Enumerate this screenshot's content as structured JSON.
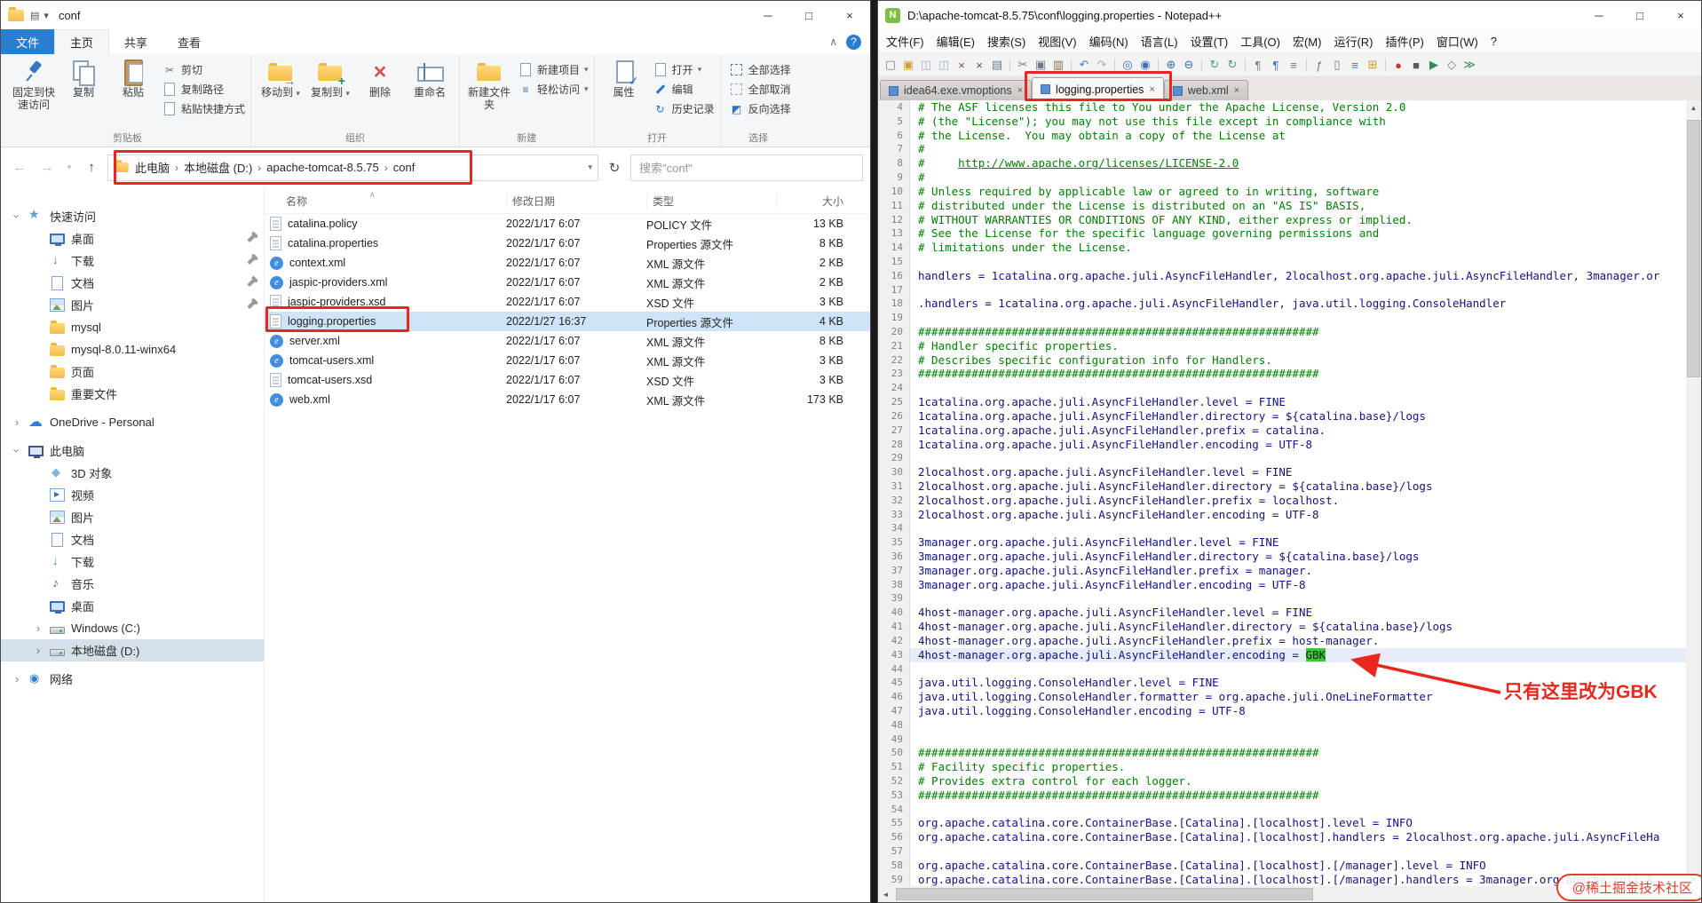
{
  "icons": {
    "back": "←",
    "forward": "→",
    "up": "↑",
    "dropdown": "▾",
    "refresh": "↻",
    "help": "?",
    "collapse": "∧",
    "min": "─",
    "max": "□",
    "close": "×",
    "chev_right": "›",
    "cut": "✂",
    "delete_x": "×",
    "history": "↻",
    "easy": "≡",
    "check": "✓",
    "invert": "◩",
    "arrow_move": "→",
    "plus": "+",
    "sort_caret": "∧",
    "scroll_up": "▲",
    "scroll_down": "▼",
    "scroll_left": "◄",
    "scroll_right": "►"
  },
  "explorer": {
    "title": "conf",
    "ribbon_tabs": [
      "文件",
      "主页",
      "共享",
      "查看"
    ],
    "ribbon": {
      "pin": "固定到快速访问",
      "copy": "复制",
      "paste": "粘贴",
      "cut": "剪切",
      "copy_path": "复制路径",
      "paste_shortcut": "粘贴快捷方式",
      "group_clipboard": "剪贴板",
      "move_to": "移动到",
      "copy_to": "复制到",
      "delete": "删除",
      "rename": "重命名",
      "group_organize": "组织",
      "new_folder": "新建文件夹",
      "new_item": "新建项目",
      "easy_access": "轻松访问",
      "group_new": "新建",
      "properties": "属性",
      "open": "打开",
      "edit": "编辑",
      "history": "历史记录",
      "group_open": "打开",
      "select_all": "全部选择",
      "select_none": "全部取消",
      "invert_selection": "反向选择",
      "group_select": "选择"
    },
    "address": {
      "crumbs": [
        "此电脑",
        "本地磁盘 (D:)",
        "apache-tomcat-8.5.75",
        "conf"
      ],
      "search": "搜索\"conf\""
    },
    "sidebar": [
      {
        "id": "quick-access",
        "label": "快速访问",
        "icon": "star",
        "chev": "down",
        "indent": 0
      },
      {
        "id": "desktop-pinned",
        "label": "桌面",
        "icon": "monitor",
        "pin": true,
        "indent": 1
      },
      {
        "id": "downloads-pinned",
        "label": "下载",
        "icon": "download",
        "pin": true,
        "indent": 1
      },
      {
        "id": "documents-pinned",
        "label": "文档",
        "icon": "doc",
        "pin": true,
        "indent": 1
      },
      {
        "id": "pictures-pinned",
        "label": "图片",
        "icon": "pic",
        "pin": true,
        "indent": 1
      },
      {
        "id": "mysql",
        "label": "mysql",
        "icon": "folder",
        "indent": 1
      },
      {
        "id": "mysql-8",
        "label": "mysql-8.0.11-winx64",
        "icon": "folder",
        "indent": 1
      },
      {
        "id": "pages",
        "label": "页面",
        "icon": "folder",
        "indent": 1
      },
      {
        "id": "important",
        "label": "重要文件",
        "icon": "folder",
        "indent": 1
      },
      {
        "id": "onedrive",
        "label": "OneDrive - Personal",
        "icon": "cloud",
        "chev": "right",
        "indent": 0,
        "gap": true
      },
      {
        "id": "this-pc",
        "label": "此电脑",
        "icon": "pc",
        "chev": "down",
        "indent": 0,
        "gap": true
      },
      {
        "id": "3d-objects",
        "label": "3D 对象",
        "icon": "obj3d",
        "indent": 1
      },
      {
        "id": "videos",
        "label": "视频",
        "icon": "video",
        "indent": 1
      },
      {
        "id": "pictures",
        "label": "图片",
        "icon": "pic",
        "indent": 1
      },
      {
        "id": "documents",
        "label": "文档",
        "icon": "doc",
        "indent": 1
      },
      {
        "id": "downloads",
        "label": "下载",
        "icon": "download",
        "indent": 1
      },
      {
        "id": "music",
        "label": "音乐",
        "icon": "music",
        "indent": 1
      },
      {
        "id": "desktop",
        "label": "桌面",
        "icon": "monitor",
        "indent": 1
      },
      {
        "id": "drive-c",
        "label": "Windows (C:)",
        "icon": "drive",
        "chev": "right",
        "indent": 1
      },
      {
        "id": "drive-d",
        "label": "本地磁盘 (D:)",
        "icon": "drive",
        "chev": "right",
        "indent": 1,
        "selected": true
      },
      {
        "id": "network",
        "label": "网络",
        "icon": "net",
        "chev": "right",
        "indent": 0,
        "gap": true
      }
    ],
    "files": {
      "columns": [
        "名称",
        "修改日期",
        "类型",
        "大小"
      ],
      "rows": [
        {
          "name": "catalina.policy",
          "icon": "doc",
          "date": "2022/1/17 6:07",
          "type": "POLICY 文件",
          "size": "13 KB"
        },
        {
          "name": "catalina.properties",
          "icon": "doc",
          "date": "2022/1/17 6:07",
          "type": "Properties 源文件",
          "size": "8 KB"
        },
        {
          "name": "context.xml",
          "icon": "xml",
          "date": "2022/1/17 6:07",
          "type": "XML 源文件",
          "size": "2 KB"
        },
        {
          "name": "jaspic-providers.xml",
          "icon": "xml",
          "date": "2022/1/17 6:07",
          "type": "XML 源文件",
          "size": "2 KB"
        },
        {
          "name": "jaspic-providers.xsd",
          "icon": "doc",
          "date": "2022/1/17 6:07",
          "type": "XSD 文件",
          "size": "3 KB"
        },
        {
          "name": "logging.properties",
          "icon": "doc",
          "date": "2022/1/27 16:37",
          "type": "Properties 源文件",
          "size": "4 KB",
          "selected": true
        },
        {
          "name": "server.xml",
          "icon": "xml",
          "date": "2022/1/17 6:07",
          "type": "XML 源文件",
          "size": "8 KB"
        },
        {
          "name": "tomcat-users.xml",
          "icon": "xml",
          "date": "2022/1/17 6:07",
          "type": "XML 源文件",
          "size": "3 KB"
        },
        {
          "name": "tomcat-users.xsd",
          "icon": "doc",
          "date": "2022/1/17 6:07",
          "type": "XSD 文件",
          "size": "3 KB"
        },
        {
          "name": "web.xml",
          "icon": "xml",
          "date": "2022/1/17 6:07",
          "type": "XML 源文件",
          "size": "173 KB"
        }
      ]
    }
  },
  "notepad": {
    "title": "D:\\apache-tomcat-8.5.75\\conf\\logging.properties - Notepad++",
    "icon_label": "N",
    "menus": [
      "文件(F)",
      "编辑(E)",
      "搜索(S)",
      "视图(V)",
      "编码(N)",
      "语言(L)",
      "设置(T)",
      "工具(O)",
      "宏(M)",
      "运行(R)",
      "插件(P)",
      "窗口(W)",
      "?"
    ],
    "toolbar": [
      {
        "n": "new-file-icon",
        "g": "▢",
        "c": "#6b7b8d"
      },
      {
        "n": "open-file-icon",
        "g": "▣",
        "c": "#d09a3e"
      },
      {
        "n": "save-icon",
        "g": "◫",
        "c": "#9fb3c8"
      },
      {
        "n": "save-all-icon",
        "g": "◫",
        "c": "#9fb3c8"
      },
      {
        "n": "close-doc-icon",
        "g": "×",
        "c": "#7d4a4a"
      },
      {
        "n": "close-all-icon",
        "g": "×",
        "c": "#7d4a4a"
      },
      {
        "n": "print-icon",
        "g": "▤",
        "c": "#6b7b8d"
      },
      {
        "sep": true
      },
      {
        "n": "cut-icon",
        "g": "✂",
        "c": "#6b7b8d"
      },
      {
        "n": "copy-icon",
        "g": "▣",
        "c": "#6b7b8d"
      },
      {
        "n": "paste-icon",
        "g": "▥",
        "c": "#8a6d4a"
      },
      {
        "sep": true
      },
      {
        "n": "undo-icon",
        "g": "↶",
        "c": "#4f7fc9"
      },
      {
        "n": "redo-icon",
        "g": "↷",
        "c": "#9fb3c8"
      },
      {
        "sep": true
      },
      {
        "n": "find-icon",
        "g": "◎",
        "c": "#3a6fb0"
      },
      {
        "n": "replace-icon",
        "g": "◉",
        "c": "#3a6fb0"
      },
      {
        "sep": true
      },
      {
        "n": "zoom-in-icon",
        "g": "⊕",
        "c": "#3a6fb0"
      },
      {
        "n": "zoom-out-icon",
        "g": "⊖",
        "c": "#3a6fb0"
      },
      {
        "sep": true
      },
      {
        "n": "sync-vertical-icon",
        "g": "↻",
        "c": "#4f9f6f"
      },
      {
        "n": "sync-horizontal-icon",
        "g": "↻",
        "c": "#4f9f6f"
      },
      {
        "sep": true
      },
      {
        "n": "word-wrap-icon",
        "g": "¶",
        "c": "#6b7b8d"
      },
      {
        "n": "show-all-chars-icon",
        "g": "¶",
        "c": "#3a6fb0"
      },
      {
        "n": "indent-guide-icon",
        "g": "≡",
        "c": "#6b7b8d"
      },
      {
        "sep": true
      },
      {
        "n": "function-list-icon",
        "g": "ƒ",
        "c": "#6b7b8d"
      },
      {
        "n": "doc-map-icon",
        "g": "▯",
        "c": "#6b7b8d"
      },
      {
        "n": "doc-list-icon",
        "g": "≡",
        "c": "#3a6fb0"
      },
      {
        "n": "folder-workspace-icon",
        "g": "⊞",
        "c": "#d09a3e"
      },
      {
        "sep": true
      },
      {
        "n": "macro-record-icon",
        "g": "●",
        "c": "#c23b2e"
      },
      {
        "n": "macro-stop-icon",
        "g": "■",
        "c": "#5a5a5a"
      },
      {
        "n": "macro-play-icon",
        "g": "▶",
        "c": "#2e8b57"
      },
      {
        "n": "macro-save-icon",
        "g": "◇",
        "c": "#6b7b8d"
      },
      {
        "n": "macro-run-multiple-icon",
        "g": "≫",
        "c": "#2e8b57"
      }
    ],
    "tabs": [
      {
        "label": "idea64.exe.vmoptions",
        "active": false
      },
      {
        "label": "logging.properties",
        "active": true
      },
      {
        "label": "web.xml",
        "active": false
      }
    ],
    "editor": {
      "lines": [
        {
          "n": 4,
          "s": [
            [
              "c",
              "# The ASF licenses this file to You under the Apache License, Version 2.0"
            ]
          ]
        },
        {
          "n": 5,
          "s": [
            [
              "c",
              "# (the \"License\"); you may not use this file except in compliance with"
            ]
          ]
        },
        {
          "n": 6,
          "s": [
            [
              "c",
              "# the License.  You may obtain a copy of the License at"
            ]
          ]
        },
        {
          "n": 7,
          "s": [
            [
              "c",
              "#"
            ]
          ]
        },
        {
          "n": 8,
          "s": [
            [
              "c",
              "#     "
            ],
            [
              "u",
              "http://www.apache.org/licenses/LICENSE-2.0"
            ]
          ]
        },
        {
          "n": 9,
          "s": [
            [
              "c",
              "#"
            ]
          ]
        },
        {
          "n": 10,
          "s": [
            [
              "c",
              "# Unless required by applicable law or agreed to in writing, software"
            ]
          ]
        },
        {
          "n": 11,
          "s": [
            [
              "c",
              "# distributed under the License is distributed on an \"AS IS\" BASIS,"
            ]
          ]
        },
        {
          "n": 12,
          "s": [
            [
              "c",
              "# WITHOUT WARRANTIES OR CONDITIONS OF ANY KIND, either express or implied."
            ]
          ]
        },
        {
          "n": 13,
          "s": [
            [
              "c",
              "# See the License for the specific language governing permissions and"
            ]
          ]
        },
        {
          "n": 14,
          "s": [
            [
              "c",
              "# limitations under the License."
            ]
          ]
        },
        {
          "n": 15,
          "s": []
        },
        {
          "n": 16,
          "s": [
            [
              "k",
              "handlers = 1catalina.org.apache.juli.AsyncFileHandler, 2localhost.org.apache.juli.AsyncFileHandler, 3manager.or"
            ]
          ]
        },
        {
          "n": 17,
          "s": []
        },
        {
          "n": 18,
          "s": [
            [
              "k",
              ".handlers = 1catalina.org.apache.juli.AsyncFileHandler, java.util.logging.ConsoleHandler"
            ]
          ]
        },
        {
          "n": 19,
          "s": []
        },
        {
          "n": 20,
          "s": [
            [
              "c",
              "############################################################"
            ]
          ]
        },
        {
          "n": 21,
          "s": [
            [
              "c",
              "# Handler specific properties."
            ]
          ]
        },
        {
          "n": 22,
          "s": [
            [
              "c",
              "# Describes specific configuration info for Handlers."
            ]
          ]
        },
        {
          "n": 23,
          "s": [
            [
              "c",
              "############################################################"
            ]
          ]
        },
        {
          "n": 24,
          "s": []
        },
        {
          "n": 25,
          "s": [
            [
              "k",
              "1catalina.org.apache.juli.AsyncFileHandler.level = FINE"
            ]
          ]
        },
        {
          "n": 26,
          "s": [
            [
              "k",
              "1catalina.org.apache.juli.AsyncFileHandler.directory = ${catalina.base}/logs"
            ]
          ]
        },
        {
          "n": 27,
          "s": [
            [
              "k",
              "1catalina.org.apache.juli.AsyncFileHandler.prefix = catalina."
            ]
          ]
        },
        {
          "n": 28,
          "s": [
            [
              "k",
              "1catalina.org.apache.juli.AsyncFileHandler.encoding = UTF-8"
            ]
          ]
        },
        {
          "n": 29,
          "s": []
        },
        {
          "n": 30,
          "s": [
            [
              "k",
              "2localhost.org.apache.juli.AsyncFileHandler.level = FINE"
            ]
          ]
        },
        {
          "n": 31,
          "s": [
            [
              "k",
              "2localhost.org.apache.juli.AsyncFileHandler.directory = ${catalina.base}/logs"
            ]
          ]
        },
        {
          "n": 32,
          "s": [
            [
              "k",
              "2localhost.org.apache.juli.AsyncFileHandler.prefix = localhost."
            ]
          ]
        },
        {
          "n": 33,
          "s": [
            [
              "k",
              "2localhost.org.apache.juli.AsyncFileHandler.encoding = UTF-8"
            ]
          ]
        },
        {
          "n": 34,
          "s": []
        },
        {
          "n": 35,
          "s": [
            [
              "k",
              "3manager.org.apache.juli.AsyncFileHandler.level = FINE"
            ]
          ]
        },
        {
          "n": 36,
          "s": [
            [
              "k",
              "3manager.org.apache.juli.AsyncFileHandler.directory = ${catalina.base}/logs"
            ]
          ]
        },
        {
          "n": 37,
          "s": [
            [
              "k",
              "3manager.org.apache.juli.AsyncFileHandler.prefix = manager."
            ]
          ]
        },
        {
          "n": 38,
          "s": [
            [
              "k",
              "3manager.org.apache.juli.AsyncFileHandler.encoding = UTF-8"
            ]
          ]
        },
        {
          "n": 39,
          "s": []
        },
        {
          "n": 40,
          "s": [
            [
              "k",
              "4host-manager.org.apache.juli.AsyncFileHandler.level = FINE"
            ]
          ]
        },
        {
          "n": 41,
          "s": [
            [
              "k",
              "4host-manager.org.apache.juli.AsyncFileHandler.directory = ${catalina.base}/logs"
            ]
          ]
        },
        {
          "n": 42,
          "s": [
            [
              "k",
              "4host-manager.org.apache.juli.AsyncFileHandler.prefix = host-manager."
            ]
          ]
        },
        {
          "n": 43,
          "cur": true,
          "s": [
            [
              "k",
              "4host-manager.org.apache.juli.AsyncFileHandler.encoding = "
            ],
            [
              "hl",
              "GBK"
            ]
          ]
        },
        {
          "n": 44,
          "s": []
        },
        {
          "n": 45,
          "s": [
            [
              "k",
              "java.util.logging.ConsoleHandler.level = FINE"
            ]
          ]
        },
        {
          "n": 46,
          "s": [
            [
              "k",
              "java.util.logging.ConsoleHandler.formatter = org.apache.juli.OneLineFormatter"
            ]
          ]
        },
        {
          "n": 47,
          "s": [
            [
              "k",
              "java.util.logging.ConsoleHandler.encoding = UTF-8"
            ]
          ]
        },
        {
          "n": 48,
          "s": []
        },
        {
          "n": 49,
          "s": []
        },
        {
          "n": 50,
          "s": [
            [
              "c",
              "############################################################"
            ]
          ]
        },
        {
          "n": 51,
          "s": [
            [
              "c",
              "# Facility specific properties."
            ]
          ]
        },
        {
          "n": 52,
          "s": [
            [
              "c",
              "# Provides extra control for each logger."
            ]
          ]
        },
        {
          "n": 53,
          "s": [
            [
              "c",
              "############################################################"
            ]
          ]
        },
        {
          "n": 54,
          "s": []
        },
        {
          "n": 55,
          "s": [
            [
              "k",
              "org.apache.catalina.core.ContainerBase.[Catalina].[localhost].level = INFO"
            ]
          ]
        },
        {
          "n": 56,
          "s": [
            [
              "k",
              "org.apache.catalina.core.ContainerBase.[Catalina].[localhost].handlers = 2localhost.org.apache.juli.AsyncFileHa"
            ]
          ]
        },
        {
          "n": 57,
          "s": []
        },
        {
          "n": 58,
          "s": [
            [
              "k",
              "org.apache.catalina.core.ContainerBase.[Catalina].[localhost].[/manager].level = INFO"
            ]
          ]
        },
        {
          "n": 59,
          "s": [
            [
              "k",
              "org.apache.catalina.core.ContainerBase.[Catalina].[localhost].[/manager].handlers = 3manager.org.apache.juli.A"
            ]
          ]
        }
      ]
    }
  },
  "annotations": {
    "tip": "只有这里改为GBK"
  },
  "watermark": "@稀土掘金技术社区"
}
